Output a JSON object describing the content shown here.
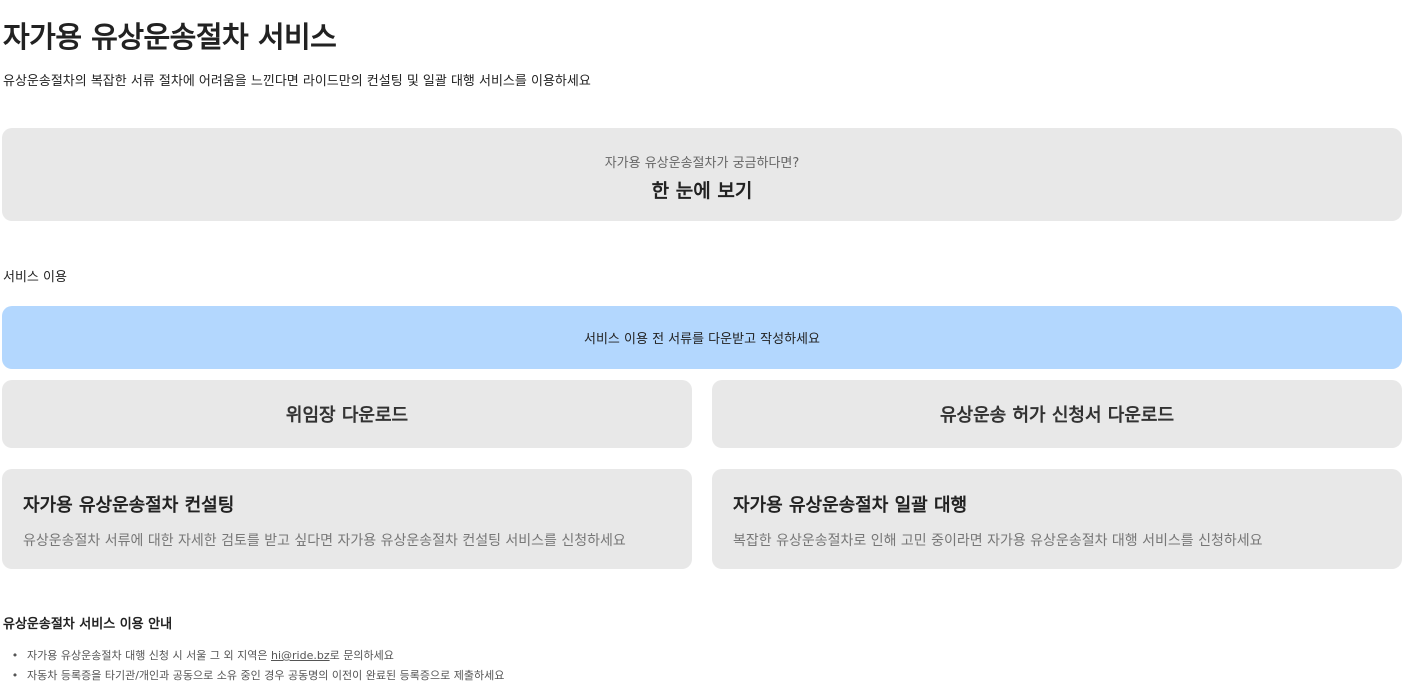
{
  "header": {
    "title": "자가용 유상운송절차 서비스",
    "subtitle": "유상운송절차의 복잡한 서류 절차에 어려움을 느낀다면 라이드만의 컨설팅 및 일괄 대행 서비스를 이용하세요"
  },
  "overview": {
    "question": "자가용 유상운송절차가 궁금하다면?",
    "cta": "한 눈에 보기"
  },
  "service_section": {
    "label": "서비스 이용",
    "notice": "서비스 이용 전 서류를 다운받고 작성하세요",
    "downloads": [
      {
        "label": "위임장 다운로드"
      },
      {
        "label": "유상운송 허가 신청서 다운로드"
      }
    ],
    "cards": [
      {
        "title": "자가용 유상운송절차 컨설팅",
        "description": "유상운송절차 서류에 대한 자세한 검토를 받고 싶다면 자가용 유상운송절차 컨설팅 서비스를 신청하세요"
      },
      {
        "title": "자가용 유상운송절차 일괄 대행",
        "description": "복잡한 유상운송절차로 인해 고민 중이라면 자가용 유상운송절차 대행 서비스를 신청하세요"
      }
    ]
  },
  "guide": {
    "title": "유상운송절차 서비스 이용 안내",
    "bullet": "•",
    "item1_before": "자가용 유상운송절차 대행 신청 시 서울 그 외 지역은 ",
    "item1_email": "hi@ride.bz",
    "item1_after": "로 문의하세요",
    "item2": "자동차 등록증을 타기관/개인과 공동으로 소유 중인 경우 공동명의 이전이 완료된 등록증으로 제출하세요"
  },
  "colors": {
    "card_bg": "#e8e8e8",
    "notice_bg": "#b3d7fe",
    "text": "#222222",
    "muted_text": "#777777"
  }
}
